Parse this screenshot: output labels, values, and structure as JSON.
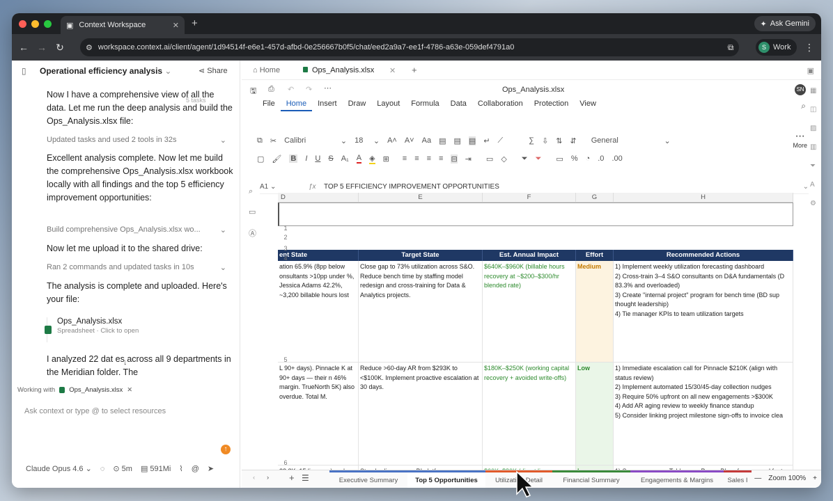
{
  "browser": {
    "tab_title": "Context Workspace",
    "url": "workspace.context.ai/client/agent/1d94514f-e6e1-457d-afbd-0e256667b0f5/chat/eed2a9a7-ee1f-4786-a63e-059def4791a0",
    "ask_gemini": "Ask Gemini",
    "profile_initial": "S",
    "profile_label": "Work"
  },
  "chat": {
    "title": "Operational efficiency analysis",
    "share": "Share",
    "tasks_badge": "5 tasks",
    "messages": [
      "Now I have a comprehensive view of all the data. Let me run the deep analysis and build the Ops_Analysis.xlsx file:",
      "Excellent analysis complete. Now let me build the comprehensive Ops_Analysis.xlsx workbook locally with all findings and the top 5 efficiency improvement opportunities:",
      "Now let me upload it to the shared drive:",
      "The analysis is complete and uploaded. Here's your file:",
      "I analyzed 22 dat  es across all 9 departments in the Meridian folder. The"
    ],
    "tools": [
      "Updated tasks and used 2 tools in 32s",
      "Build comprehensive Ops_Analysis.xlsx wo...",
      "Ran 2 commands and updated tasks in 10s"
    ],
    "file_name": "Ops_Analysis.xlsx",
    "file_sub": "Spreadsheet · Click to open",
    "working_with": "Working with",
    "working_file": "Ops_Analysis.xlsx",
    "input_placeholder": "Ask context or type @ to select resources",
    "model": "Claude Opus 4.6",
    "time": "5m",
    "tokens": "591Mi"
  },
  "app": {
    "home": "Home",
    "file_tab": "Ops_Analysis.xlsx"
  },
  "sheet": {
    "filename": "Ops_Analysis.xlsx",
    "user_initials": "SN",
    "menus": [
      "File",
      "Home",
      "Insert",
      "Draw",
      "Layout",
      "Formula",
      "Data",
      "Collaboration",
      "Protection",
      "View"
    ],
    "font": "Calibri",
    "size": "18",
    "number_format": "General",
    "more": "More",
    "cell_ref": "A1",
    "formula": "TOP 5 EFFICIENCY IMPROVEMENT OPPORTUNITIES",
    "columns": [
      "D",
      "E",
      "F",
      "G",
      "H"
    ],
    "rows": [
      "1",
      "2",
      "3",
      "4",
      "5",
      "6"
    ],
    "headers": [
      "ent State",
      "Target State",
      "Est. Annual Impact",
      "Effort",
      "Recommended Actions"
    ],
    "r5": {
      "d": "ation 65.9% (8pp below onsultants >10pp under %, Jessica Adams 42.2%, ~3,200 billable hours lost",
      "e": "Close gap to 73% utilization across S&O. Reduce bench time by staffing model redesign and cross-training for Data & Analytics projects.",
      "f": "$640K–$960K (billable hours recovery at ~$200–$300/hr blended rate)",
      "g": "Medium",
      "h": "1) Implement weekly utilization forecasting dashboard\n2) Cross-train 3–4 S&O consultants on D&A fundamentals (D 83.3% and overloaded)\n3) Create \"internal project\" program for bench time (BD sup thought leadership)\n4) Tie manager KPIs to team utilization targets"
    },
    "r6": {
      "d": "L 90+ days). Pinnacle K at 90+ days — their n 46% margin. TrueNorth 5K) also overdue. Total M.",
      "e": "Reduce >60-day AR from $293K to <$100K. Implement proactive escalation at 30 days.",
      "f": "$180K–$250K (working capital recovery + avoided write-offs)",
      "g": "Low",
      "h": "1) Immediate escalation call for Pinnacle $210K (align with status review)\n2) Implement automated 15/30/45-day collection nudges\n3) Require 50% upfront on all new engagements >$300K\n4) Add AR aging review to weekly finance standup\n5) Consider linking project milestone sign-offs to invoice clea"
    },
    "r7": {
      "d": "28.8K, 15 licenses) and",
      "e": "Standardize on one BI platform.",
      "f": "$60K–$80K (direct license",
      "g": "Low",
      "h": "1) Survey users on Tableau vs Power BI preference and feat"
    },
    "tabs": [
      "Executive Summary",
      "Top 5 Opportunities",
      "Utilization Detail",
      "Financial Summary",
      "Engagements & Margins",
      "Sales I"
    ],
    "tab_colors": [
      "#4a73c4",
      "#4a73c4",
      "#e05a2b",
      "#3a8a3a",
      "#8a4ac4",
      "#c43a3a"
    ],
    "zoom": "Zoom 100%"
  }
}
